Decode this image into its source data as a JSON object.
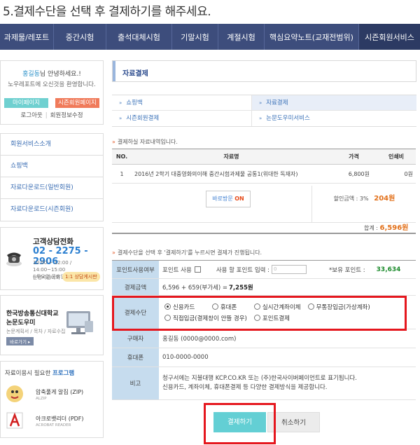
{
  "heading": "5.결제수단을 선택 후 결제하기를 해주세요.",
  "topnav": [
    "과제물/레포트",
    "중간시험",
    "출석대체시험",
    "기말시험",
    "계절시험",
    "핵심요약노트(교재전범위)",
    "시즌회원서비스"
  ],
  "sidebar": {
    "user_name": "홍길동",
    "hello_suffix": "님 안녕하세요.!",
    "welcome": "노우레포트에 오신것을 환영합니다.",
    "mypage": "마이페이지",
    "member_page": "시즌회원페이지",
    "logout": "로그아웃",
    "edit_info": "회원정보수정",
    "menu": [
      "회원서비스소개",
      "쇼핑백",
      "자료다운로드(일반회원)",
      "자료다운로드(시즌회원)"
    ],
    "cs": {
      "title": "고객상담전화",
      "phone": "02 - 2275 - 2906",
      "hours1": "10:00 ~ 12:00 / 14:00~15:00",
      "hours2": "( 토요일,공휴일 휴무)",
      "run": "운영시간이외",
      "chat": "1:1 상담게시판"
    },
    "univ": {
      "line1": "한국방송통신대학교",
      "line2": "논문도우미",
      "line3": "논문계획서 / 목차 / 자료수집",
      "btn": "바로가기 ▸"
    },
    "programs": {
      "title_prefix": "자료이용시 필요한 ",
      "title_bold": "프로그램",
      "items": [
        {
          "name": "압축풀게 알집 (ZIP)",
          "eng": "ALZIP"
        },
        {
          "name": "아크로뱃리더 (PDF)",
          "eng": "ACROBAT READER"
        }
      ]
    }
  },
  "main": {
    "title": "자료결제",
    "submenu": [
      "쇼핑백",
      "자료결제",
      "시즌회원결제",
      "논문도우미서비스"
    ],
    "order_caption": "결제하실 자료내역입니다.",
    "table": {
      "headers": [
        "NO.",
        "자료명",
        "가격",
        "인쇄비"
      ],
      "rows": [
        [
          "1",
          "2016년 2학기 대중영화의이해 중간시험과제물 공통1(위대한 독재자)",
          "6,800원",
          "0원"
        ]
      ]
    },
    "direct_visit": "바로방문",
    "direct_on": "ON",
    "discount_label": "할인금액 : 3%",
    "discount_value": "204원",
    "total_label": "합계 : ",
    "total_value": "6,596원",
    "pay_caption": "결제수단을 선택 후 '결제하기'를 누르시면 결제가 진행됩니다.",
    "form": {
      "point_label": "포인트사용여부",
      "point_use": "포인트 사용",
      "point_input_label": "사용 할 포인트 입력 :",
      "point_input_value": "0",
      "own_point_label": "*보유 포인트 :",
      "own_point_value": "33,634",
      "amount_label": "결제금액",
      "amount_prefix": "6,596 + 659(부가세) = ",
      "amount_total": "7,255원",
      "method_label": "결제수단",
      "methods": [
        "신용카드",
        "휴대폰",
        "실시간계좌이체",
        "무통장입금(가상계좌)",
        "직접입금(결제창이 안뜰 경우)",
        "포인트결제"
      ],
      "selected_method": "신용카드",
      "buyer_label": "구매자",
      "buyer_value": "홍길동 (0000@0000.com)",
      "phone_label": "휴대폰",
      "phone_value": "010-0000-0000",
      "note_label": "비고",
      "note_line1": "청구서에는 지불대행 KCP.CO.KR 또는 (주)한국사이버페이먼트로 표기됩니다.",
      "note_line2": "신용카드, 계좌이체, 휴대폰결제 등 다양한 결제방식을 제공합니다."
    },
    "pay_button": "결제하기",
    "cancel_button": "취소하기"
  },
  "colors": {
    "nav": "#3d4d7c",
    "accent_teal": "#63cfd4",
    "highlight_red": "#e5171e",
    "label_bg": "#c6dcee"
  }
}
